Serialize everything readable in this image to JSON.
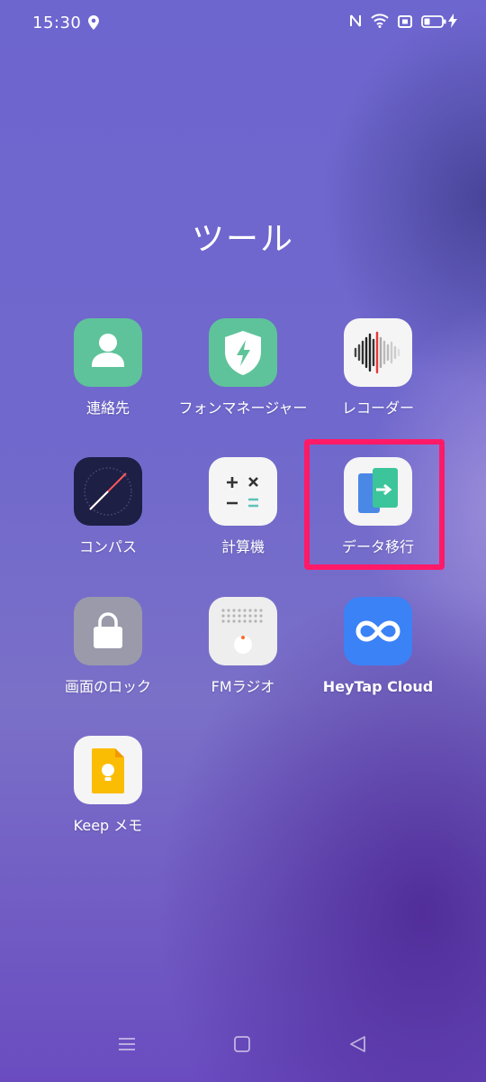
{
  "status_bar": {
    "time": "15:30",
    "icons": [
      "location-icon",
      "nfc-icon",
      "wifi-icon",
      "sim-icon",
      "battery-icon",
      "charging-icon"
    ]
  },
  "folder": {
    "title": "ツール",
    "apps": [
      {
        "label": "連絡先",
        "icon": "contacts-icon"
      },
      {
        "label": "フォンマネージャー",
        "icon": "phone-manager-icon"
      },
      {
        "label": "レコーダー",
        "icon": "recorder-icon"
      },
      {
        "label": "コンパス",
        "icon": "compass-icon"
      },
      {
        "label": "計算機",
        "icon": "calculator-icon"
      },
      {
        "label": "データ移行",
        "icon": "data-transfer-icon",
        "highlighted": true
      },
      {
        "label": "画面のロック",
        "icon": "lock-icon"
      },
      {
        "label": "FMラジオ",
        "icon": "fm-radio-icon"
      },
      {
        "label": "HeyTap Cloud",
        "icon": "heytap-cloud-icon"
      },
      {
        "label": "Keep メモ",
        "icon": "keep-notes-icon"
      }
    ]
  },
  "navigation": [
    "menu-icon",
    "home-icon",
    "back-icon"
  ],
  "colors": {
    "highlight": "#ff1a68",
    "contacts": "#5ec39a",
    "heytap": "#3b82f6",
    "keep": "#fbbc04"
  }
}
